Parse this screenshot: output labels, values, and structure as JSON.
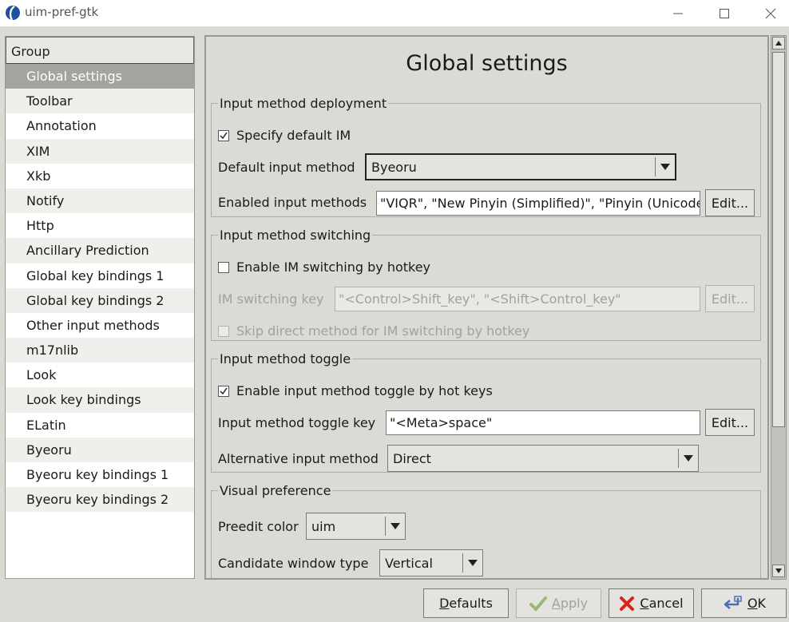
{
  "window": {
    "title": "uim-pref-gtk"
  },
  "groups": {
    "header": "Group",
    "items": [
      "Global settings",
      "Toolbar",
      "Annotation",
      "XIM",
      "Xkb",
      "Notify",
      "Http",
      "Ancillary Prediction",
      "Global key bindings 1",
      "Global key bindings 2",
      "Other input methods",
      "m17nlib",
      "Look",
      "Look key bindings",
      "ELatin",
      "Byeoru",
      "Byeoru key bindings 1",
      "Byeoru key bindings 2"
    ],
    "selected_index": 0
  },
  "page": {
    "title": "Global settings"
  },
  "deployment": {
    "legend": "Input method deployment",
    "specify_default_label": "Specify default IM",
    "specify_default_checked": true,
    "default_im_label": "Default input method",
    "default_im_value": "Byeoru",
    "enabled_label": "Enabled input methods",
    "enabled_value": "\"VIQR\", \"New Pinyin (Simplified)\", \"Pinyin (Unicode)\"",
    "edit_label": "Edit..."
  },
  "switching": {
    "legend": "Input method switching",
    "enable_label": "Enable IM switching by hotkey",
    "enable_checked": false,
    "key_label": "IM switching key",
    "key_value": "\"<Control>Shift_key\", \"<Shift>Control_key\"",
    "edit_label": "Edit...",
    "skip_label": "Skip direct method for IM switching by hotkey",
    "skip_checked": false
  },
  "toggle": {
    "legend": "Input method toggle",
    "enable_label": "Enable input method toggle by hot keys",
    "enable_checked": true,
    "key_label": "Input method toggle key",
    "key_value": "\"<Meta>space\"",
    "edit_label": "Edit...",
    "alt_label": "Alternative input method",
    "alt_value": "Direct"
  },
  "visual": {
    "legend": "Visual preference",
    "preedit_label": "Preedit color",
    "preedit_value": "uim",
    "candidate_label": "Candidate window type",
    "candidate_value": "Vertical"
  },
  "buttons": {
    "defaults": "Defaults",
    "defaults_mnemonic": "D",
    "defaults_rest": "efaults",
    "apply_mnemonic": "A",
    "apply_rest": "pply",
    "cancel_mnemonic": "C",
    "cancel_rest": "ancel",
    "ok_mnemonic": "O",
    "ok_rest": "K"
  },
  "icons": {
    "app": "uim-logo-icon",
    "apply": "checkmark-icon",
    "cancel": "x-icon",
    "ok": "ok-arrow-icon"
  },
  "colors": {
    "selected_row": "#a5a39d",
    "cancel_icon": "#d9231a",
    "apply_icon": "#9ab87a",
    "ok_icon": "#4a6fb5"
  }
}
